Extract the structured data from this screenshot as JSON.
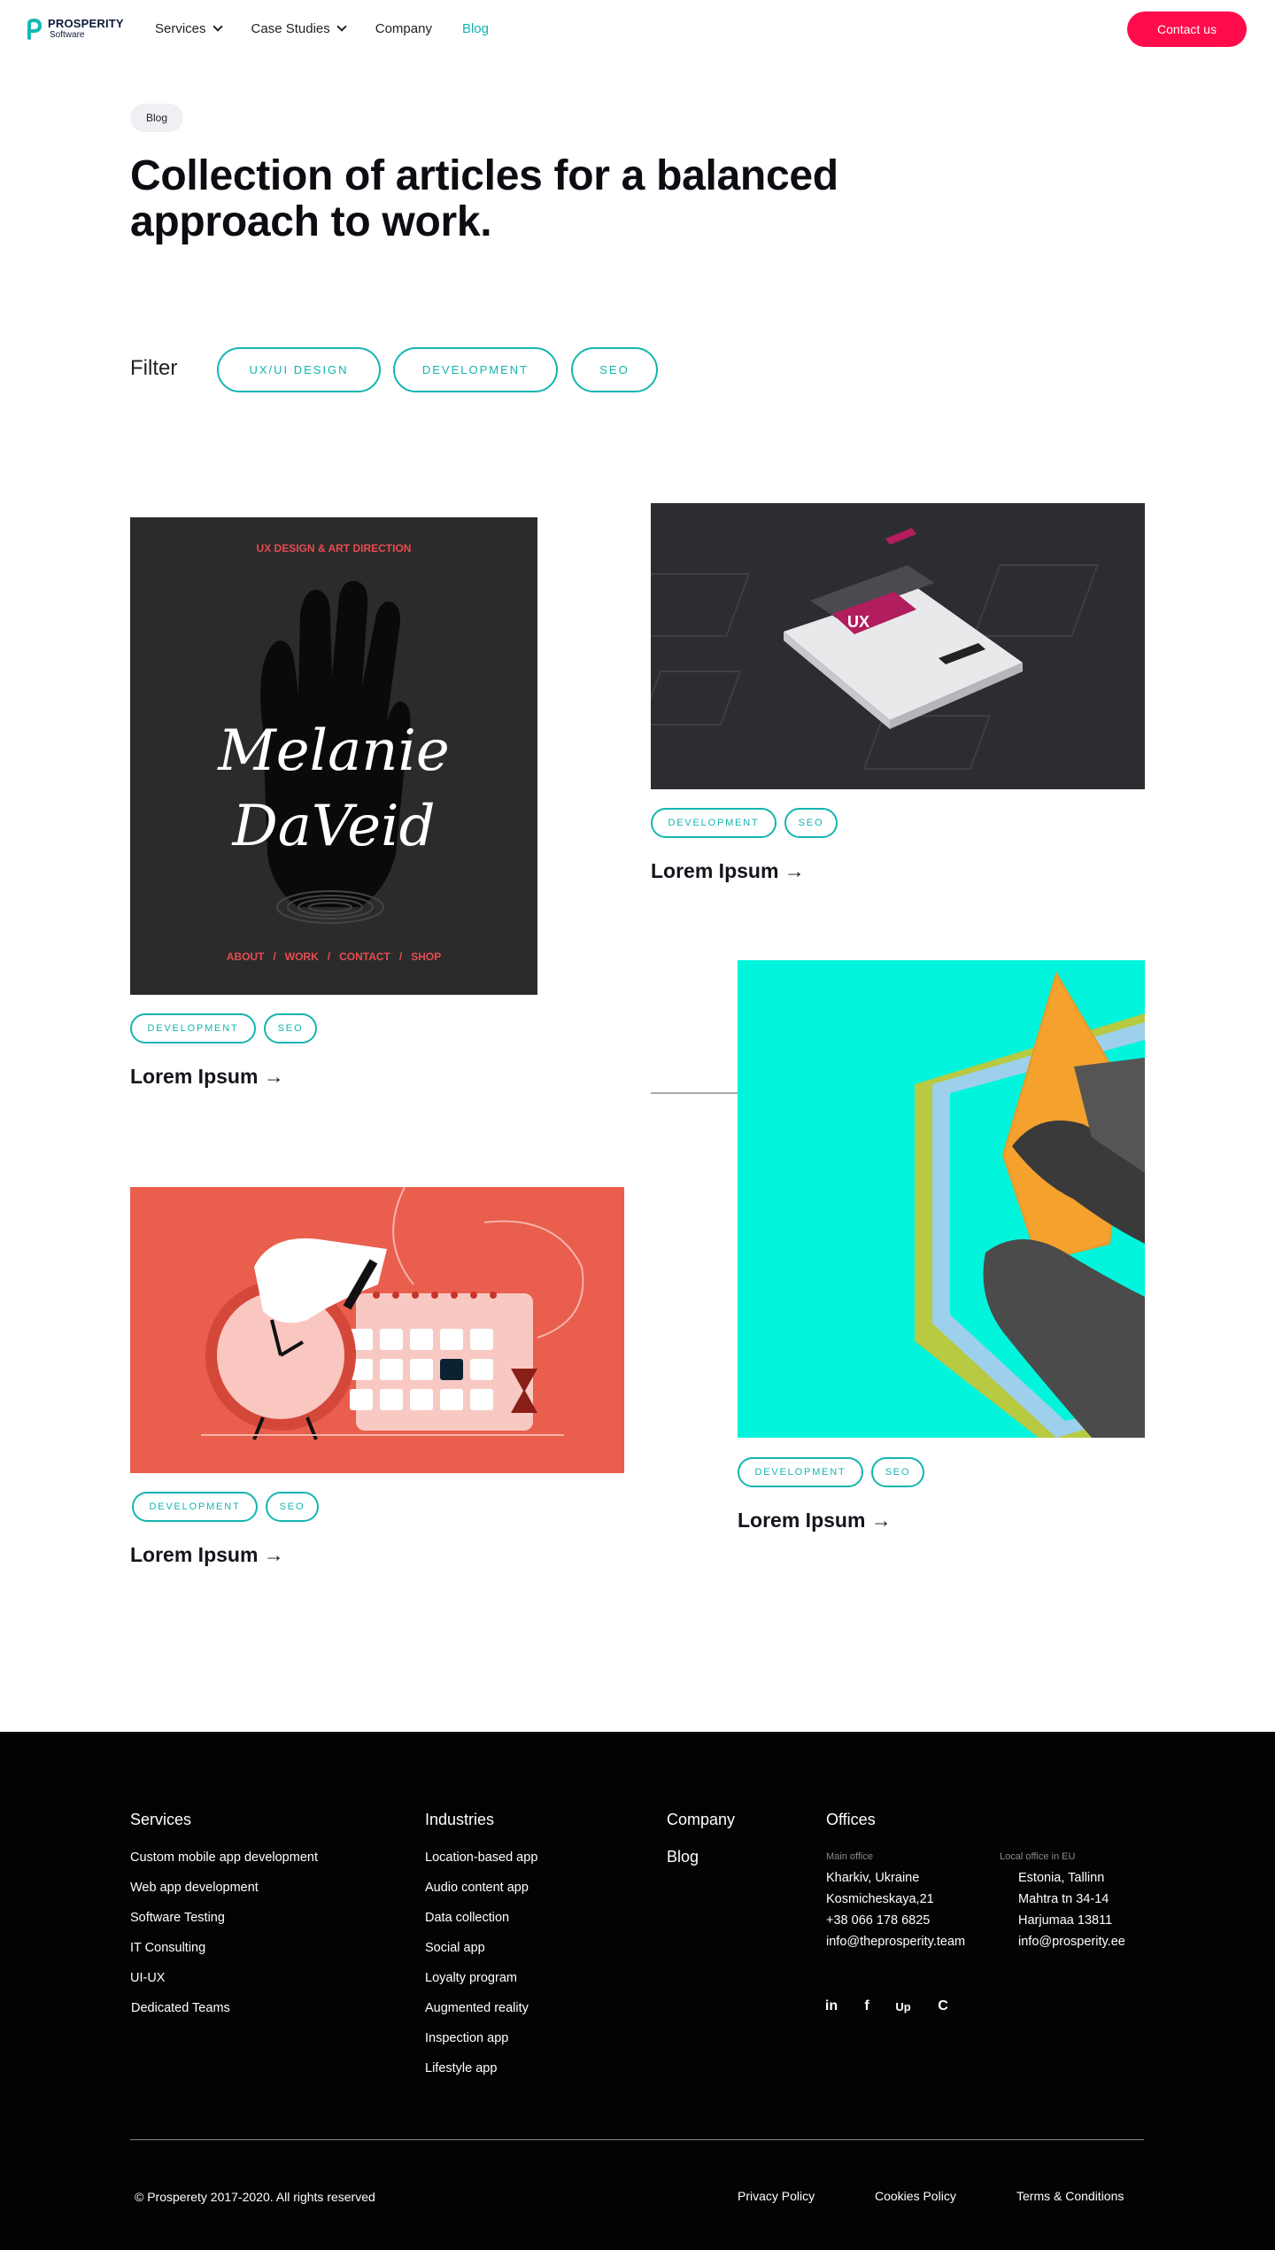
{
  "header": {
    "logo_name": "PROSPERITY",
    "logo_sub": "Software",
    "nav": [
      {
        "label": "Services"
      },
      {
        "label": "Case Studies"
      },
      {
        "label": "Company"
      },
      {
        "label": "Blog"
      }
    ],
    "contact_label": "Contact us"
  },
  "hero": {
    "breadcrumb": "Blog",
    "title_line1": "Collection of articles for a balanced",
    "title_line2": "approach to work."
  },
  "filter": {
    "label": "Filter",
    "options": [
      "UX/UI DESIGN",
      "DEVELOPMENT",
      "SEO"
    ]
  },
  "cards": [
    {
      "tags": [
        "DEVELOPMENT",
        "SEO"
      ],
      "title": "Lorem Ipsum →",
      "image": {
        "heading": "UX DESIGN & ART DIRECTION",
        "script1": "Melanie",
        "script2": "DaVeid",
        "menu": "ABOUT   /   WORK   /   CONTACT   /   SHOP"
      }
    },
    {
      "tags": [
        "DEVELOPMENT",
        "SEO"
      ],
      "title": "Lorem Ipsum →",
      "image": {
        "badge": "UX"
      }
    },
    {
      "tags": [
        "DEVELOPMENT",
        "SEO"
      ],
      "title": "Lorem Ipsum →"
    },
    {
      "tags": [
        "DEVELOPMENT",
        "SEO"
      ],
      "title": "Lorem Ipsum →"
    }
  ],
  "footer": {
    "services_title": "Services",
    "services": [
      "Custom mobile app development",
      "Web app development",
      "Software Testing",
      "IT Consulting",
      "UI-UX",
      "Dedicated Teams"
    ],
    "industries_title": "Industries",
    "industries": [
      "Location-based app",
      "Audio content app",
      "Data collection",
      "Social app",
      "Loyalty program",
      "Augmented reality",
      "Inspection app",
      "Lifestyle app"
    ],
    "company_title": "Company",
    "company_links": [
      "Blog"
    ],
    "offices_title": "Offices",
    "main_office_label": "Main office",
    "main_office": [
      "Kharkiv, Ukraine",
      "Kosmicheskaya,21",
      "+38 066 178 6825",
      "info@theprosperity.team"
    ],
    "eu_office_label": "Local office in EU",
    "eu_office": [
      "Estonia, Tallinn",
      "Mahtra tn 34-14",
      "Harjumaa 13811",
      "info@prosperity.ee"
    ],
    "social": [
      "in",
      "f",
      "Up",
      "C"
    ],
    "copyright": "© Prosperety 2017-2020. All rights reserved",
    "legal": [
      "Privacy Policy",
      "Cookies Policy",
      "Terms & Conditions"
    ]
  },
  "colors": {
    "accent": "#13b5b0",
    "cta": "#ff0a4a",
    "footer_bg": "#030303"
  }
}
